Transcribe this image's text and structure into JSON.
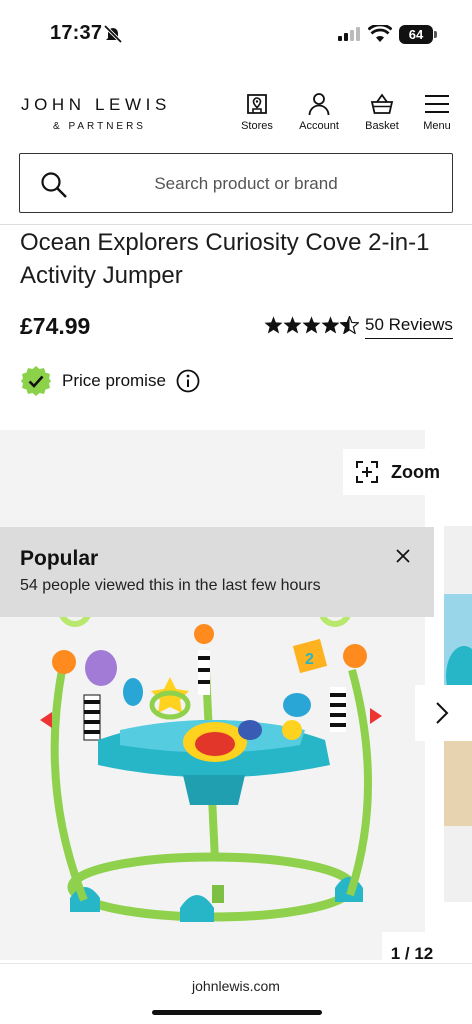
{
  "status": {
    "time": "17:37",
    "battery": "64"
  },
  "header": {
    "brand": "JOHN LEWIS",
    "brand_sub": "& PARTNERS",
    "nav": [
      {
        "label": "Stores",
        "icon": "store-icon"
      },
      {
        "label": "Account",
        "icon": "person-icon"
      },
      {
        "label": "Basket",
        "icon": "basket-icon"
      },
      {
        "label": "Menu",
        "icon": "hamburger-icon"
      }
    ]
  },
  "search": {
    "placeholder": "Search product or brand"
  },
  "product": {
    "title": "Ocean Explorers Curiosity Cove 2-in-1 Activity Jumper",
    "price": "£74.99",
    "rating": 4.5,
    "reviews_label": "50 Reviews",
    "price_promise": "Price promise"
  },
  "gallery": {
    "zoom_label": "Zoom",
    "counter": "1 / 12",
    "popular_title": "Popular",
    "popular_text": "54 people viewed this in the last few hours"
  },
  "footer": {
    "url": "johnlewis.com"
  },
  "colors": {
    "promise_badge": "#8bd14a",
    "gallery_bg": "#f3f3f3",
    "banner_bg": "#dcdcdc"
  }
}
